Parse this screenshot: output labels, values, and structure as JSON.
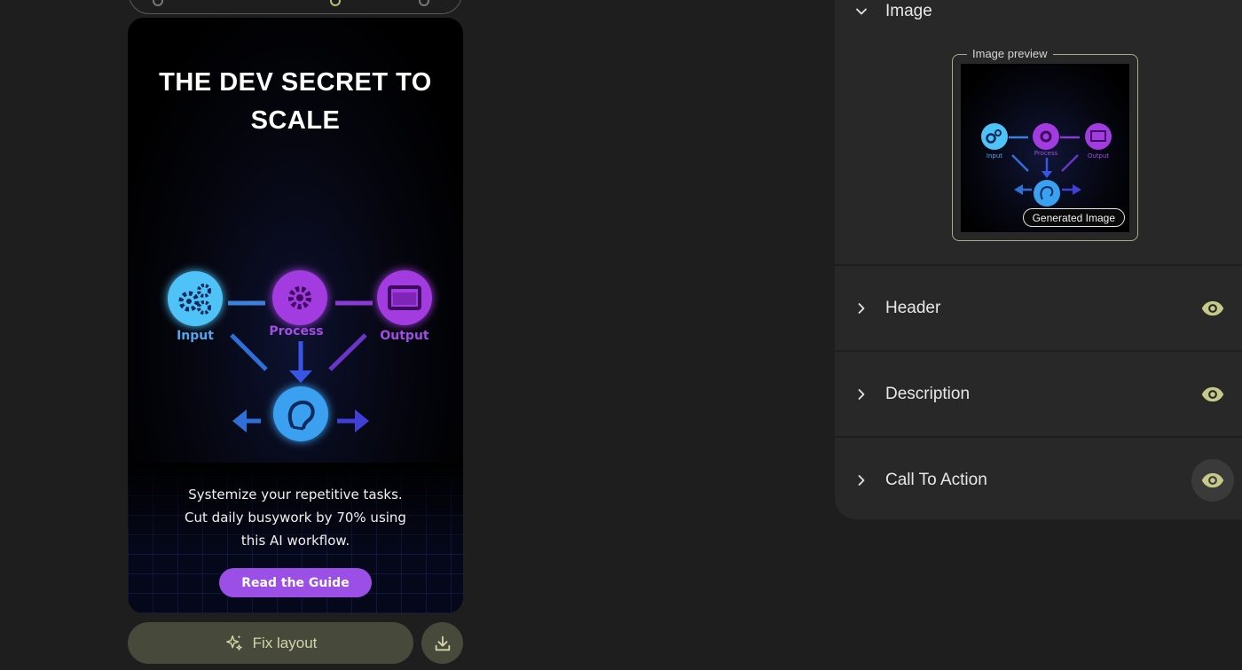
{
  "ad": {
    "title": "THE DEV SECRET TO SCALE",
    "diagram": {
      "input_label": "Input",
      "process_label": "Process",
      "output_label": "Output"
    },
    "description_lines": [
      "Systemize your repetitive tasks.",
      "Cut daily busywork by 70% using",
      "this AI workflow."
    ],
    "cta_label": "Read the Guide",
    "colors": {
      "input": "#4fc3f7",
      "process": "#a23be0",
      "output": "#a23be0",
      "center": "#3aa0f0",
      "cta": "#9b4fe6"
    }
  },
  "controls": {
    "fix_layout_label": "Fix layout",
    "fix_layout_icon": "sparkle-icon",
    "download_icon": "download-icon"
  },
  "panel": {
    "image_section": {
      "label": "Image",
      "preview_label": "Image preview",
      "badge": "Generated Image",
      "expanded": true
    },
    "sections": [
      {
        "label": "Header",
        "visible": true
      },
      {
        "label": "Description",
        "visible": true
      },
      {
        "label": "Call To Action",
        "visible": true
      }
    ],
    "accent_color": "#c5c98a"
  }
}
